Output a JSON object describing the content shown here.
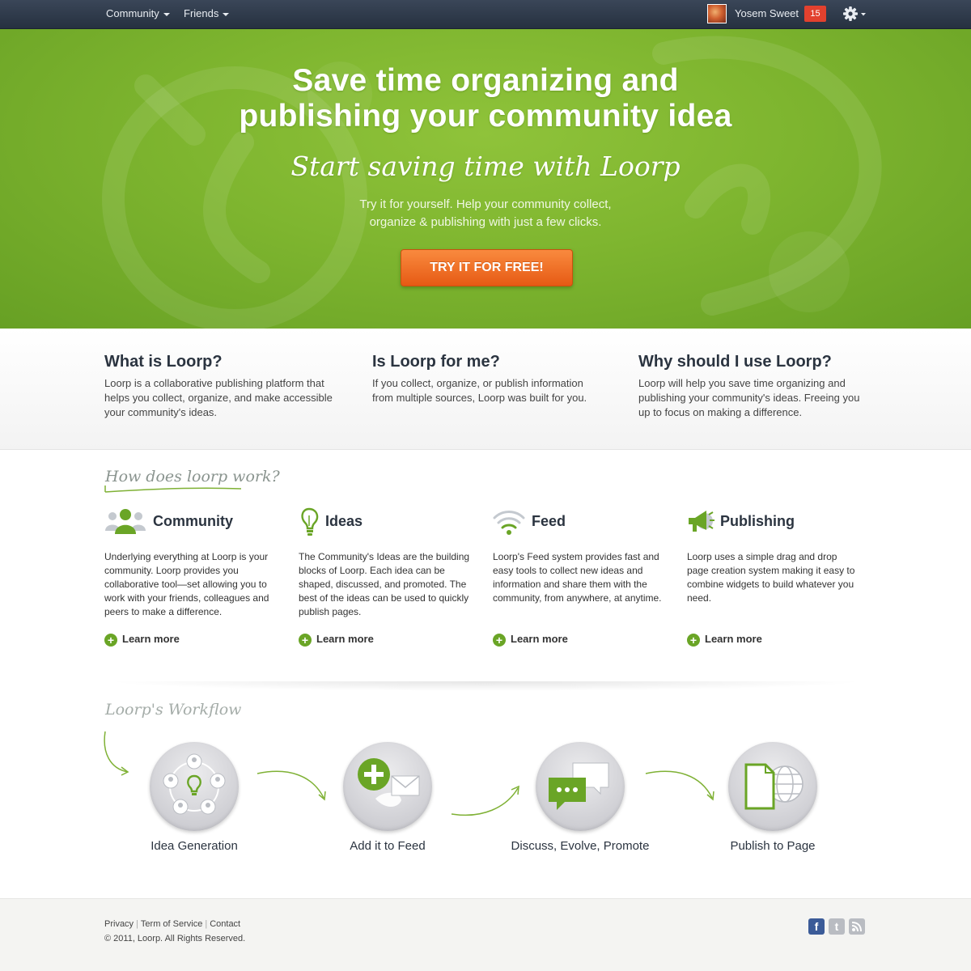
{
  "topbar": {
    "nav": [
      {
        "label": "Community"
      },
      {
        "label": "Friends"
      }
    ],
    "user": {
      "name": "Yosem Sweet",
      "notifications": "15"
    },
    "icons": {
      "avatar": "avatar-image",
      "settings": "gear-icon"
    }
  },
  "hero": {
    "title_line1": "Save time organizing and",
    "title_line2": "publishing your community idea",
    "script": "Start saving time with Loorp",
    "text_line1": "Try it for yourself. Help your community collect,",
    "text_line2": "organize & publishing with just a few clicks.",
    "cta": "TRY IT FOR FREE!"
  },
  "info": [
    {
      "title": "What is Loorp?",
      "text": "Loorp is a collaborative publishing platform that helps you collect, organize, and make accessible your community's ideas."
    },
    {
      "title": "Is Loorp for me?",
      "text": "If you collect, organize, or publish information from multiple sources, Loorp was built for you."
    },
    {
      "title": "Why should I use Loorp?",
      "text": "Loorp will help you save time organizing and publishing your community's ideas. Freeing you up to focus on making a difference."
    }
  ],
  "how": {
    "title": "How does loorp work?",
    "features": [
      {
        "title": "Community",
        "icon": "people-icon",
        "desc": "Underlying everything at Loorp is your community. Loorp provides you collaborative tool—set allowing you to work with your friends, colleagues and peers to make a difference.",
        "more": "Learn more"
      },
      {
        "title": "Ideas",
        "icon": "lightbulb-icon",
        "desc": "The Community's Ideas are the building blocks of Loorp. Each idea can be shaped, discussed, and promoted. The best of the ideas can be used to quickly publish pages.",
        "more": "Learn more"
      },
      {
        "title": "Feed",
        "icon": "wifi-icon",
        "desc": "Loorp's Feed system provides fast and easy tools to collect new ideas and information and share them with the community, from anywhere, at anytime.",
        "more": "Learn more"
      },
      {
        "title": "Publishing",
        "icon": "megaphone-icon",
        "desc": "Loorp uses a simple drag and drop page creation system making it easy to combine widgets to build whatever you need.",
        "more": "Learn more"
      }
    ]
  },
  "workflow": {
    "title": "Loorp's Workflow",
    "steps": [
      {
        "label": "Idea Generation",
        "icon": "idea-network-icon"
      },
      {
        "label": "Add it to Feed",
        "icon": "add-feed-icon"
      },
      {
        "label": "Discuss, Evolve, Promote",
        "icon": "chat-bubbles-icon"
      },
      {
        "label": "Publish to Page",
        "icon": "page-globe-icon"
      }
    ]
  },
  "footer": {
    "links": [
      {
        "label": "Privacy"
      },
      {
        "label": "Term of Service"
      },
      {
        "label": "Contact"
      }
    ],
    "copyright": "© 2011, Loorp. All Rights Reserved.",
    "social": {
      "facebook": "facebook-icon",
      "twitter": "twitter-icon",
      "rss": "rss-icon"
    }
  },
  "colors": {
    "brand_green": "#7eb52f",
    "cta_orange": "#f07a2a",
    "topbar": "#2f3a4a",
    "accent_green": "#6aa526",
    "badge_red": "#e2412e"
  }
}
